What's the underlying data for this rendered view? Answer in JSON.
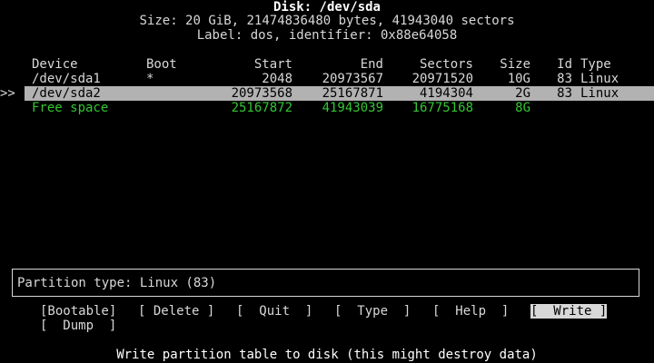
{
  "header": {
    "disk": "Disk: /dev/sda",
    "size": "Size: 20 GiB, 21474836480 bytes, 41943040 sectors",
    "label": "Label: dos, identifier: 0x88e64058"
  },
  "table": {
    "columns": {
      "device": "Device",
      "boot": "Boot",
      "start": "Start",
      "end": "End",
      "sectors": "Sectors",
      "size": "Size",
      "id": "Id",
      "type": "Type"
    },
    "rows": [
      {
        "marker": "",
        "device": "/dev/sda1",
        "boot": "*",
        "start": "2048",
        "end": "20973567",
        "sectors": "20971520",
        "size": "10G",
        "id": "83",
        "type": "Linux"
      },
      {
        "marker": ">>",
        "device": "/dev/sda2",
        "boot": "",
        "start": "20973568",
        "end": "25167871",
        "sectors": "4194304",
        "size": "2G",
        "id": "83",
        "type": "Linux"
      },
      {
        "marker": "",
        "device": "Free space",
        "boot": "",
        "start": "25167872",
        "end": "41943039",
        "sectors": "16775168",
        "size": "8G",
        "id": "",
        "type": ""
      }
    ]
  },
  "status": {
    "text": "Partition type: Linux (83)"
  },
  "menu": {
    "bootable": "[Bootable]",
    "delete": "[ Delete ]",
    "quit": "[  Quit  ]",
    "type": "[  Type  ]",
    "help": "[  Help  ]",
    "write": "[  Write ]",
    "dump": "[  Dump  ]"
  },
  "help_text": "Write partition table to disk (this might destroy data)",
  "colors": {
    "background": "#000000",
    "text": "#d8d8d8",
    "selected_row_bg": "#b2b2b2",
    "free_space": "#33c633"
  }
}
